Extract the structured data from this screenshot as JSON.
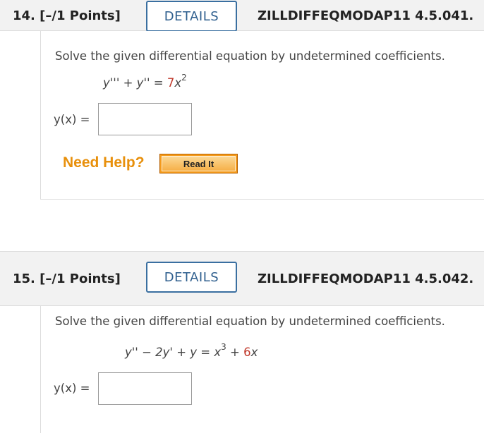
{
  "q14": {
    "number": "14.",
    "points": "[–/1 Points]",
    "details_label": "DETAILS",
    "code": "ZILLDIFFEQMODAP11 4.5.041.",
    "prompt": "Solve the given differential equation by undetermined coefficients.",
    "eq_lhs": "y''' + y'' = ",
    "eq_coef": "7",
    "eq_var": "x",
    "eq_exp": "2",
    "answer_label": "y(x) =",
    "answer_value": "",
    "need_help": "Need Help?",
    "read_it": "Read It"
  },
  "q15": {
    "number": "15.",
    "points": "[–/1 Points]",
    "details_label": "DETAILS",
    "code": "ZILLDIFFEQMODAP11 4.5.042.",
    "prompt": "Solve the given differential equation by undetermined coefficients.",
    "eq_lhs": "y'' − 2y' + y = ",
    "eq_var": "x",
    "eq_exp": "3",
    "eq_plus": " + ",
    "eq_coef2": "6",
    "eq_var2": "x",
    "answer_label": "y(x) =",
    "answer_value": ""
  },
  "colors": {
    "accent": "#2f5f8e",
    "help": "#e8900c",
    "given_value": "#c0392b",
    "readit_bg": "#f59b1b"
  }
}
